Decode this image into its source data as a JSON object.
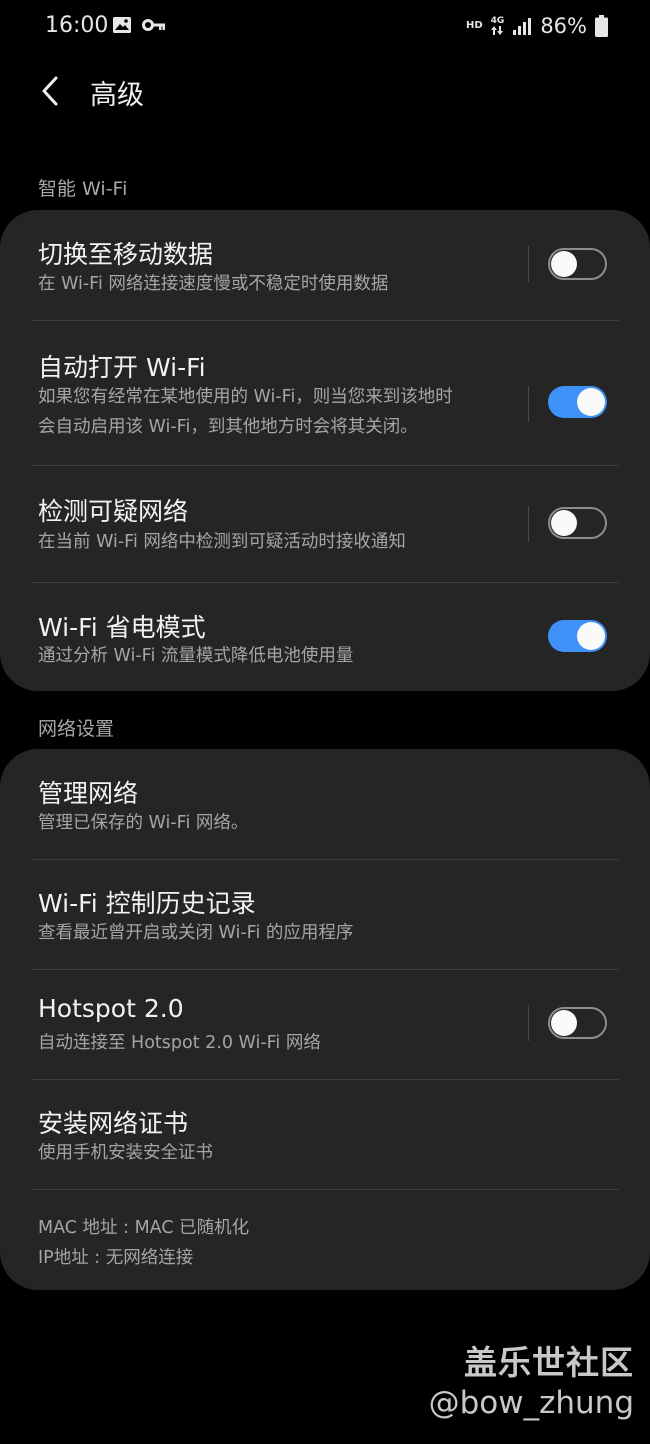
{
  "status_bar": {
    "time": "16:00",
    "hd": "HD",
    "network": "4G",
    "battery": "86%"
  },
  "header": {
    "title": "高级"
  },
  "sections": {
    "smart_wifi": {
      "label": "智能 Wi-Fi",
      "items": [
        {
          "title": "切换至移动数据",
          "subtitle": "在 Wi-Fi 网络连接速度慢或不稳定时使用数据",
          "toggle": false
        },
        {
          "title": "自动打开 Wi-Fi",
          "subtitle_line1": "如果您有经常在某地使用的 Wi-Fi，则当您来到该地时",
          "subtitle_line2": "会自动启用该 Wi-Fi，到其他地方时会将其关闭。",
          "toggle": true
        },
        {
          "title": "检测可疑网络",
          "subtitle": "在当前 Wi-Fi 网络中检测到可疑活动时接收通知",
          "toggle": false
        },
        {
          "title": "Wi-Fi 省电模式",
          "subtitle": "通过分析 Wi-Fi 流量模式降低电池使用量",
          "toggle": true
        }
      ]
    },
    "network_settings": {
      "label": "网络设置",
      "items": [
        {
          "title": "管理网络",
          "subtitle": "管理已保存的 Wi-Fi 网络。"
        },
        {
          "title": "Wi-Fi 控制历史记录",
          "subtitle": "查看最近曾开启或关闭 Wi-Fi 的应用程序"
        },
        {
          "title": "Hotspot 2.0",
          "subtitle": "自动连接至 Hotspot 2.0 Wi-Fi 网络",
          "toggle": false
        },
        {
          "title": "安装网络证书",
          "subtitle": "使用手机安装安全证书"
        }
      ],
      "mac_address": "MAC 地址 : MAC 已随机化",
      "ip_address": "IP地址 : 无网络连接"
    }
  },
  "watermark": {
    "line1": "盖乐世社区",
    "line2": "@bow_zhung"
  },
  "colors": {
    "background": "#000000",
    "card": "#252525",
    "accent": "#3e91f7"
  }
}
